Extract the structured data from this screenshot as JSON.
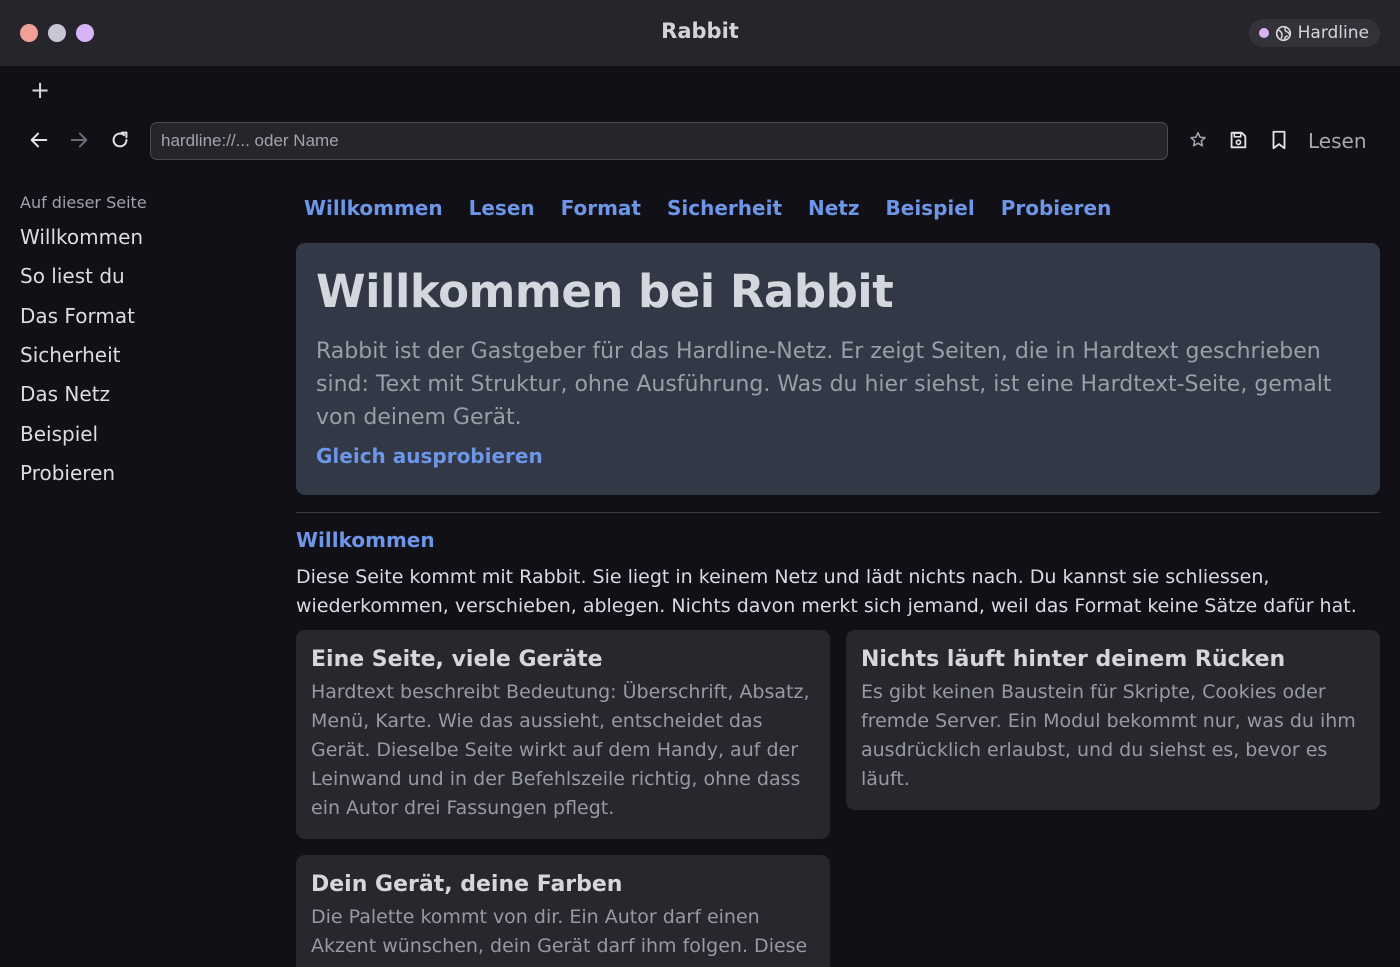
{
  "window": {
    "title": "Rabbit",
    "network_badge": "Hardline",
    "accent": "#d6b4f5"
  },
  "tabs": {
    "new_tab_label": "+"
  },
  "toolbar": {
    "url_placeholder": "hardline://... oder Name",
    "url_value": "",
    "read_label": "Lesen",
    "icons": [
      "arrow-left-icon",
      "arrow-right-icon",
      "reload-icon",
      "star-icon",
      "save-icon",
      "bookmark-icon"
    ]
  },
  "sidebar": {
    "title": "Auf dieser Seite",
    "items": [
      "Willkommen",
      "So liest du",
      "Das Format",
      "Sicherheit",
      "Das Netz",
      "Beispiel",
      "Probieren"
    ]
  },
  "anchor_nav": [
    "Willkommen",
    "Lesen",
    "Format",
    "Sicherheit",
    "Netz",
    "Beispiel",
    "Probieren"
  ],
  "hero": {
    "title": "Willkommen bei Rabbit",
    "text": "Rabbit ist der Gastgeber für das Hardline-Netz. Er zeigt Seiten, die in Hardtext geschrieben sind: Text mit Struktur, ohne Ausführung. Was du hier siehst, ist eine Hardtext-Seite, gemalt von deinem Gerät.",
    "link": "Gleich ausprobieren"
  },
  "section": {
    "title": "Willkommen",
    "text": "Diese Seite kommt mit Rabbit. Sie liegt in keinem Netz und lädt nichts nach. Du kannst sie schliessen, wiederkommen, verschieben, ablegen. Nichts davon merkt sich jemand, weil das Format keine Sätze dafür hat."
  },
  "cards": [
    {
      "title": "Eine Seite, viele Geräte",
      "text": "Hardtext beschreibt Bedeutung: Überschrift, Absatz, Menü, Karte. Wie das aussieht, entscheidet das Gerät. Dieselbe Seite wirkt auf dem Handy, auf der Leinwand und in der Befehlszeile richtig, ohne dass ein Autor drei Fassungen pflegt."
    },
    {
      "title": "Nichts läuft hinter deinem Rücken",
      "text": "Es gibt keinen Baustein für Skripte, Cookies oder fremde Server. Ein Modul bekommt nur, was du ihm ausdrücklich erlaubst, und du siehst es, bevor es läuft."
    },
    {
      "title": "Dein Gerät, deine Farben",
      "text": "Die Palette kommt von dir. Ein Autor darf einen Akzent wünschen, dein Gerät darf ihm folgen. Diese"
    }
  ],
  "colors": {
    "link": "#6d96e9",
    "hero_bg": "#323845",
    "card_bg": "#27272d",
    "page_bg": "#111017"
  }
}
